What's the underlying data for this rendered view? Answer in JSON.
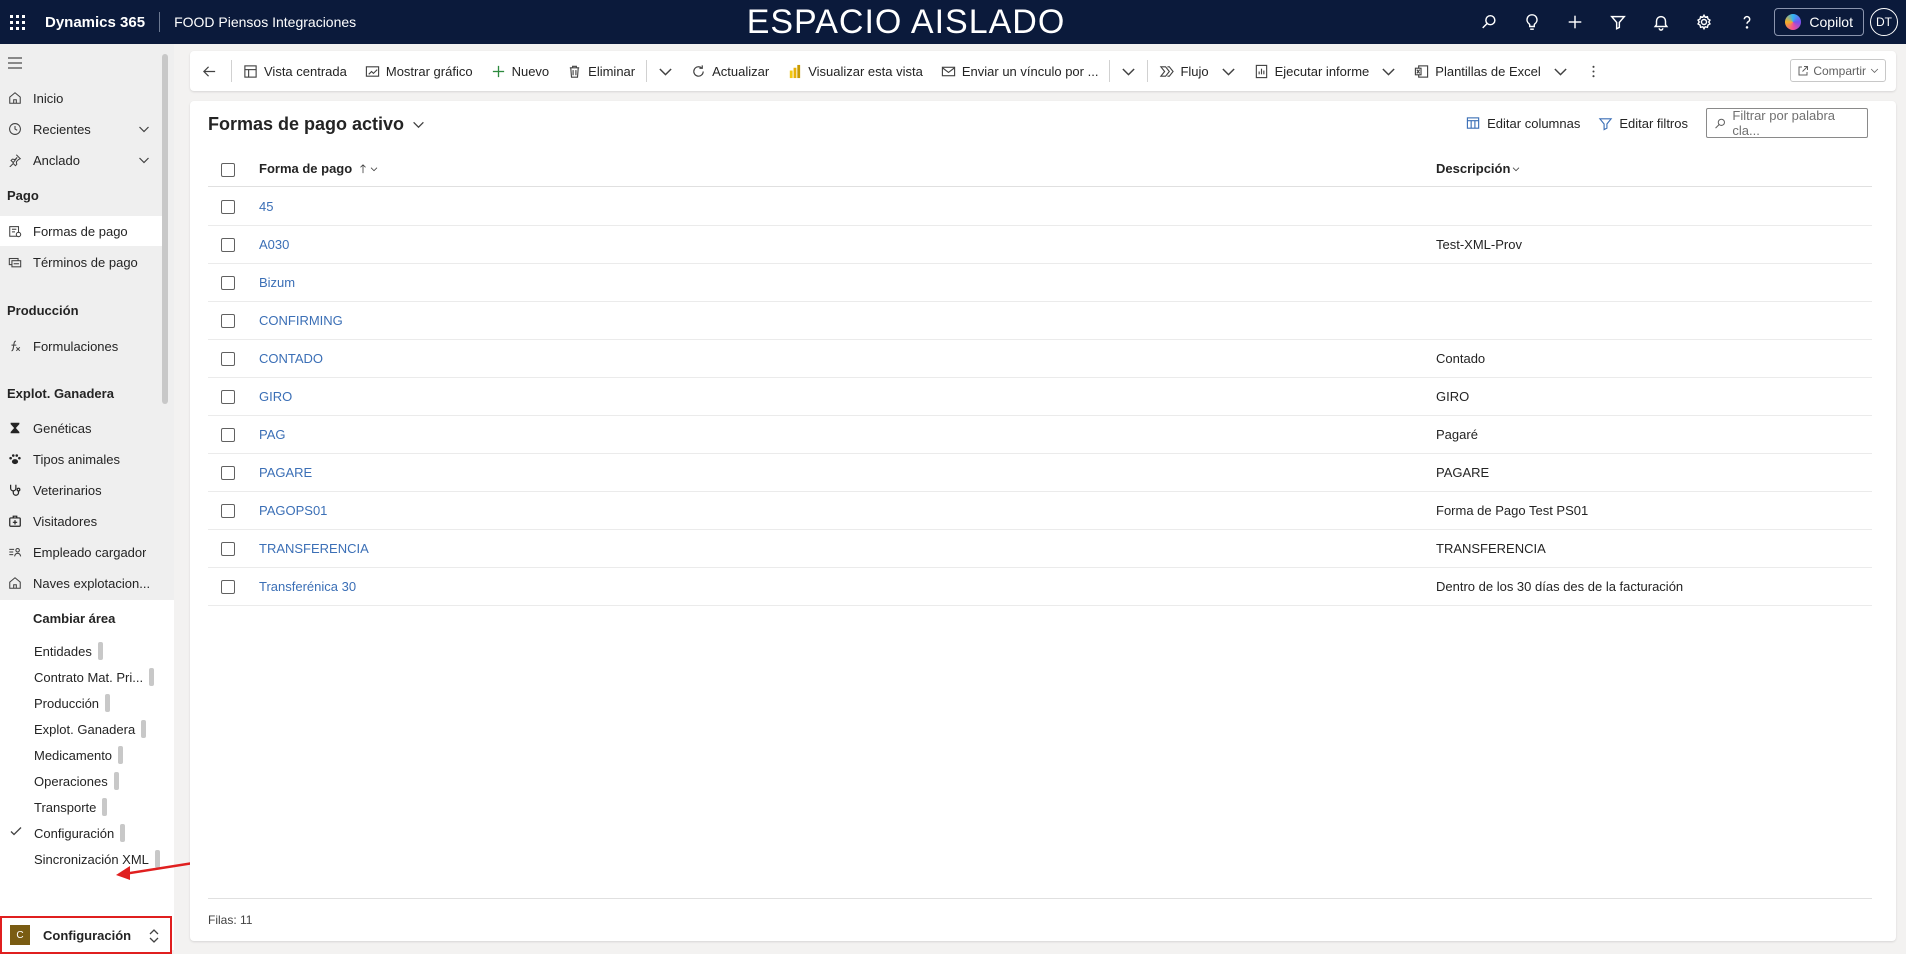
{
  "topbar": {
    "app_name": "Dynamics 365",
    "environment": "FOOD Piensos Integraciones",
    "banner": "ESPACIO AISLADO",
    "copilot_label": "Copilot",
    "user_initials": "DT",
    "icons": [
      "search-icon",
      "lightbulb-icon",
      "plus-icon",
      "filter-icon",
      "bell-icon",
      "gear-icon",
      "help-icon"
    ]
  },
  "sidebar": {
    "home": "Inicio",
    "recent": "Recientes",
    "pinned": "Anclado",
    "groups": [
      {
        "title": "Pago",
        "items": [
          {
            "label": "Formas de pago",
            "icon": "payment-method-icon",
            "selected": true
          },
          {
            "label": "Términos de pago",
            "icon": "payment-terms-icon",
            "selected": false
          }
        ]
      },
      {
        "title": "Producción",
        "items": [
          {
            "label": "Formulaciones",
            "icon": "formula-icon",
            "selected": false
          }
        ]
      },
      {
        "title": "Explot. Ganadera",
        "items": [
          {
            "label": "Genéticas",
            "icon": "hourglass-icon"
          },
          {
            "label": "Tipos animales",
            "icon": "paw-icon"
          },
          {
            "label": "Veterinarios",
            "icon": "stethoscope-icon"
          },
          {
            "label": "Visitadores",
            "icon": "medical-bag-icon"
          },
          {
            "label": "Empleado cargador",
            "icon": "employee-icon"
          },
          {
            "label": "Naves explotacion...",
            "icon": "home-icon"
          }
        ]
      }
    ],
    "area_menu": {
      "title": "Cambiar área",
      "items": [
        "Entidades",
        "Contrato Mat. Pri...",
        "Producción",
        "Explot. Ganadera",
        "Medicamento",
        "Operaciones",
        "Transporte",
        "Configuración",
        "Sincronización XML"
      ],
      "checked": "Configuración"
    },
    "area_switcher": {
      "badge": "C",
      "label": "Configuración"
    }
  },
  "commandbar": {
    "buttons": [
      "Vista centrada",
      "Mostrar gráfico",
      "Nuevo",
      "Eliminar",
      "Actualizar",
      "Visualizar esta vista",
      "Enviar un vínculo por ...",
      "Flujo",
      "Ejecutar informe",
      "Plantillas de Excel"
    ],
    "share": "Compartir"
  },
  "view": {
    "title": "Formas de pago activo",
    "edit_columns": "Editar columnas",
    "edit_filters": "Editar filtros",
    "filter_placeholder": "Filtrar por palabra cla..."
  },
  "grid": {
    "columns": [
      "Forma de pago",
      "Descripción"
    ],
    "rows": [
      {
        "name": "45",
        "desc": ""
      },
      {
        "name": "A030",
        "desc": "Test-XML-Prov"
      },
      {
        "name": "Bizum",
        "desc": ""
      },
      {
        "name": "CONFIRMING",
        "desc": ""
      },
      {
        "name": "CONTADO",
        "desc": "Contado"
      },
      {
        "name": "GIRO",
        "desc": "GIRO"
      },
      {
        "name": "PAG",
        "desc": "Pagaré"
      },
      {
        "name": "PAGARE",
        "desc": "PAGARE"
      },
      {
        "name": "PAGOPS01",
        "desc": "Forma de Pago Test PS01"
      },
      {
        "name": "TRANSFERENCIA",
        "desc": "TRANSFERENCIA"
      },
      {
        "name": "Transferénica 30",
        "desc": "Dentro de los 30 días des de la facturación"
      }
    ],
    "footer": "Filas: 11"
  },
  "colors": {
    "topbar": "#0b1a3b",
    "link": "#3b6fb6",
    "highlight_box": "#e01f1f",
    "area_badge": "#7a5c13"
  }
}
